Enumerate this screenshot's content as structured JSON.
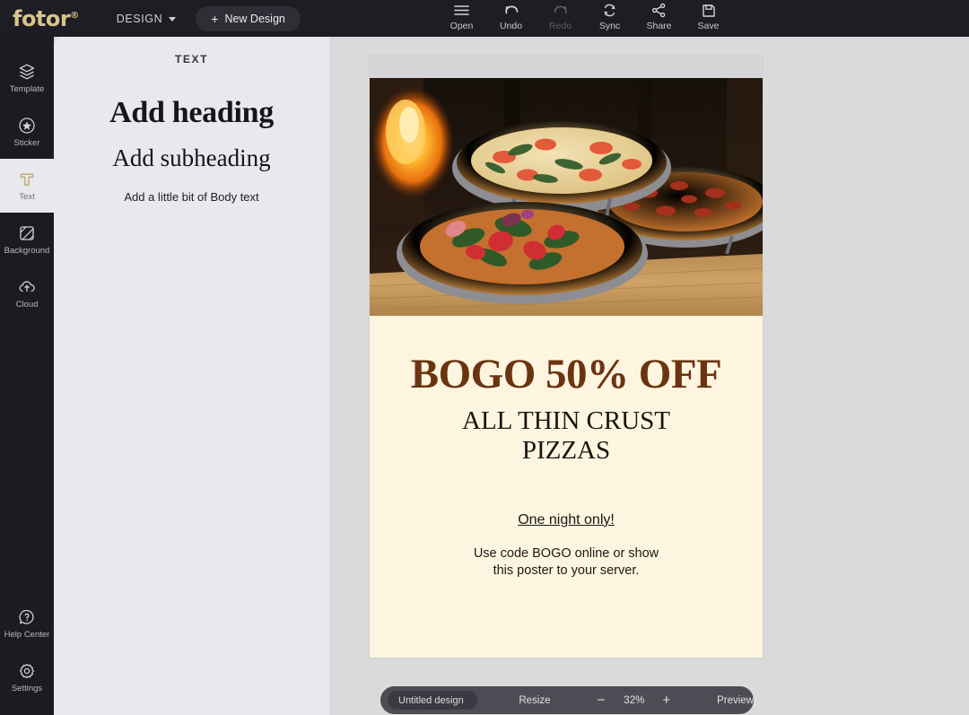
{
  "topbar": {
    "logo": "fotor",
    "logo_mark": "®",
    "design_menu": "DESIGN",
    "new_design": "New Design",
    "plus": "+",
    "tools": [
      {
        "label": "Open",
        "icon": "hamburger-menu-icon",
        "disabled": false
      },
      {
        "label": "Undo",
        "icon": "undo-arrow-icon",
        "disabled": false
      },
      {
        "label": "Redo",
        "icon": "redo-arrow-icon",
        "disabled": true
      },
      {
        "label": "Sync",
        "icon": "sync-refresh-icon",
        "disabled": false
      },
      {
        "label": "Share",
        "icon": "share-node-icon",
        "disabled": false
      },
      {
        "label": "Save",
        "icon": "floppy-disk-icon",
        "disabled": false
      }
    ]
  },
  "rail": {
    "top_items": [
      {
        "label": "Template",
        "icon": "layers-stack-icon",
        "active": false
      },
      {
        "label": "Sticker",
        "icon": "star-badge-icon",
        "active": false
      },
      {
        "label": "Text",
        "icon": "text-t-icon",
        "active": true
      },
      {
        "label": "Background",
        "icon": "hatched-square-icon",
        "active": false
      },
      {
        "label": "Cloud",
        "icon": "cloud-upload-icon",
        "active": false
      }
    ],
    "bottom_items": [
      {
        "label": "Help Center",
        "icon": "question-bubble-icon",
        "active": false
      },
      {
        "label": "Settings",
        "icon": "gear-icon",
        "active": false
      }
    ]
  },
  "panel": {
    "title": "TEXT",
    "heading": "Add heading",
    "subheading": "Add subheading",
    "body": "Add a little bit of Body text"
  },
  "poster": {
    "headline": "BOGO 50% OFF",
    "subhead_line1": "ALL THIN CRUST",
    "subhead_line2": "PIZZAS",
    "tagline": "One night only!",
    "details_line1": "Use code BOGO online or show",
    "details_line2": "this poster to your server.",
    "photo_alt": "three-pizzas-on-wooden-board-photo"
  },
  "bottombar": {
    "design_name": "Untitled design",
    "design_name_placeholder": "Untitled design",
    "resize": "Resize",
    "zoom_out": "−",
    "zoom_level": "32%",
    "zoom_in": "+",
    "preview": "Preview"
  },
  "colors": {
    "topbar_bg": "#1d1d23",
    "rail_bg": "#1b1b20",
    "panel_bg": "#e9e8ee",
    "workspace_bg": "#dadada",
    "logo_gold": "#d9c48a",
    "accent_gold": "#c7b07a",
    "poster_bg": "#fdf5e0",
    "headline_brown": "#6b3410",
    "bottombar_bg": "#4c4c54"
  }
}
